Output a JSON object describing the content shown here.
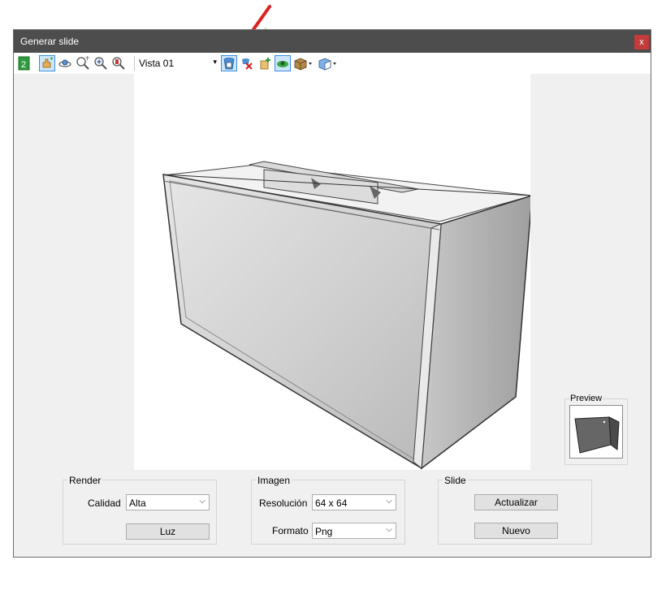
{
  "window": {
    "title": "Generar slide",
    "close_label": "x"
  },
  "toolbar": {
    "view_select_value": "Vista 01",
    "buttons": [
      "refresh-icon",
      "pan-icon",
      "orbit-icon",
      "zoom-window-icon",
      "zoom-in-icon",
      "zoom-extents-icon",
      "save-view-icon",
      "delete-view-icon",
      "new-view-icon",
      "perspective-icon",
      "box-icon",
      "render-style-icon"
    ]
  },
  "preview": {
    "label": "Preview"
  },
  "render": {
    "legend": "Render",
    "quality_label": "Calidad",
    "quality_value": "Alta",
    "light_button": "Luz"
  },
  "image": {
    "legend": "Imagen",
    "resolution_label": "Resolución",
    "resolution_value": "64 x 64",
    "format_label": "Formato",
    "format_value": "Png"
  },
  "slide": {
    "legend": "Slide",
    "update_button": "Actualizar",
    "new_button": "Nuevo"
  },
  "colors": {
    "titlebar": "#4d4d4d",
    "close": "#c43b3b",
    "annotation_arrow": "#e02020",
    "active_tool": "#cde6fb"
  }
}
